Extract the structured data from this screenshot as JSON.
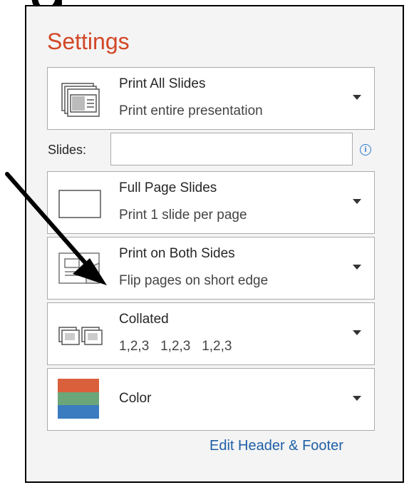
{
  "heading_fragment": "g",
  "settings_title": "Settings",
  "print_range": {
    "title": "Print All Slides",
    "subtitle": "Print entire presentation"
  },
  "slides": {
    "label": "Slides:",
    "value": "",
    "info_icon": "info-icon"
  },
  "layout": {
    "title": "Full Page Slides",
    "subtitle": "Print 1 slide per page"
  },
  "duplex": {
    "title": "Print on Both Sides",
    "subtitle": "Flip pages on short edge"
  },
  "collation": {
    "title": "Collated",
    "subtitle": "1,2,3   1,2,3   1,2,3"
  },
  "color": {
    "title": "Color",
    "swatch_colors": [
      "#d9603b",
      "#6aa67a",
      "#3b7bbf"
    ]
  },
  "edit_link": "Edit Header & Footer",
  "accent_color": "#d24726",
  "link_color": "#1f5fa6"
}
